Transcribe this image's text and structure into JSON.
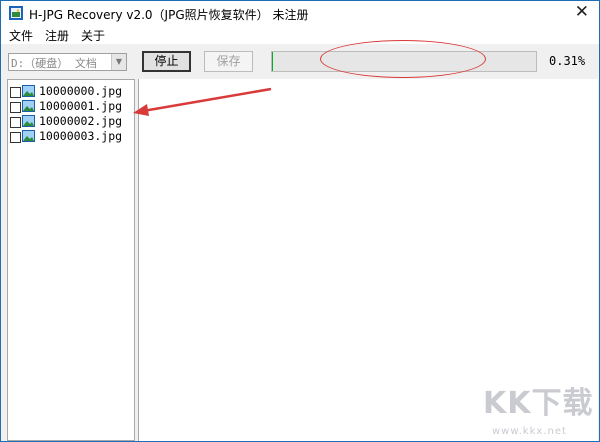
{
  "window": {
    "title": "H-JPG Recovery v2.0（JPG照片恢复软件） 未注册",
    "close_glyph": "✕"
  },
  "menu": {
    "items": [
      {
        "label": "文件"
      },
      {
        "label": "注册"
      },
      {
        "label": "关于"
      }
    ]
  },
  "toolbar": {
    "drive_value": "D:（硬盘） 文档",
    "stop_label": "停止",
    "save_label": "保存",
    "progress_fraction": 0.0031,
    "progress_text": "0.31%"
  },
  "file_list": {
    "items": [
      {
        "name": "10000000.jpg",
        "checked": false
      },
      {
        "name": "10000001.jpg",
        "checked": false
      },
      {
        "name": "10000002.jpg",
        "checked": false
      },
      {
        "name": "10000003.jpg",
        "checked": false
      }
    ]
  },
  "watermark": {
    "brand": "KK下载",
    "url": "www.kkx.net"
  },
  "colors": {
    "progress_fill": "#06b025",
    "annotation_red": "#d93a3a",
    "watermark_gray": "#c9cbd1"
  }
}
